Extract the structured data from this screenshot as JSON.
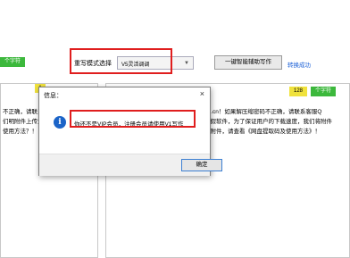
{
  "toolbar": {
    "word_badge_left": "个字符",
    "mode_label": "重写模式选择",
    "mode_select_value": "V5灵活调调",
    "rewrite_button": "一键智能辅助写作",
    "convert_status": "转换成功"
  },
  "left_panel": {
    "count_badge": "1",
    "lines": [
      "不正确，请联系",
      "",
      "们明附件上传文",
      "使用方法？！"
    ]
  },
  "right_panel": {
    "count_badge": "128",
    "word_badge": "个字符",
    "lines": [
      "69.cn！如果解压缩密码不正确，请联系客服Q",
      "恐假软件，为了保证用户的下载速度，我们将附件",
      "盘附件，请查看《网盘提取码及使用方法》！"
    ]
  },
  "dialog": {
    "title": "信息：",
    "close": "×",
    "icon": "info-icon",
    "message": "你还不是VIP会员，注册会员请使用V1写作",
    "ok_button": "确定"
  },
  "colors": {
    "highlight_red": "#e01e1e",
    "badge_green": "#3cb83c",
    "badge_yellow": "#f0e23c",
    "info_blue": "#1b64c8",
    "link_blue": "#1a5fd6"
  }
}
